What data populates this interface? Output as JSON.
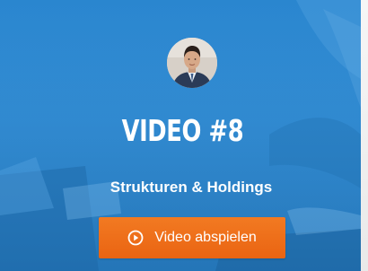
{
  "card": {
    "title": "VIDEO #8",
    "subtitle": "Strukturen & Holdings",
    "button_label": "Video abspielen",
    "button_icon": "play-circle-icon",
    "avatar_icon": "person-avatar",
    "colors": {
      "background": "#2f8ad2",
      "button": "#ef711b",
      "text": "#ffffff"
    }
  }
}
